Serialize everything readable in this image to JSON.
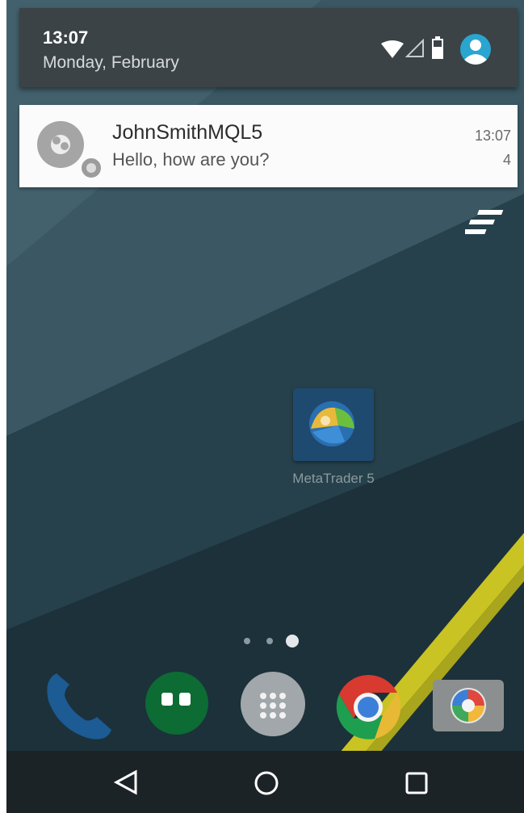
{
  "status": {
    "time": "13:07",
    "date": "Monday, February"
  },
  "notification": {
    "title": "JohnSmithMQL5",
    "text": "Hello, how are you?",
    "time": "13:07",
    "count": "4"
  },
  "home": {
    "app_label": "MetaTrader 5",
    "page_count": 3,
    "current_page": 3
  },
  "dock": [
    "phone-icon",
    "hangouts-icon",
    "app-drawer-icon",
    "chrome-icon",
    "camera-icon"
  ],
  "nav": [
    "back-icon",
    "home-icon",
    "recents-icon"
  ],
  "colors": {
    "wallpaper": "#26414b",
    "shade": "#3b4347",
    "card": "#fbfbfb",
    "accent": "#2aa5cf",
    "dock_phone": "#1c5b93",
    "hangouts": "#0d6b34",
    "stripe": "#c9c324"
  }
}
